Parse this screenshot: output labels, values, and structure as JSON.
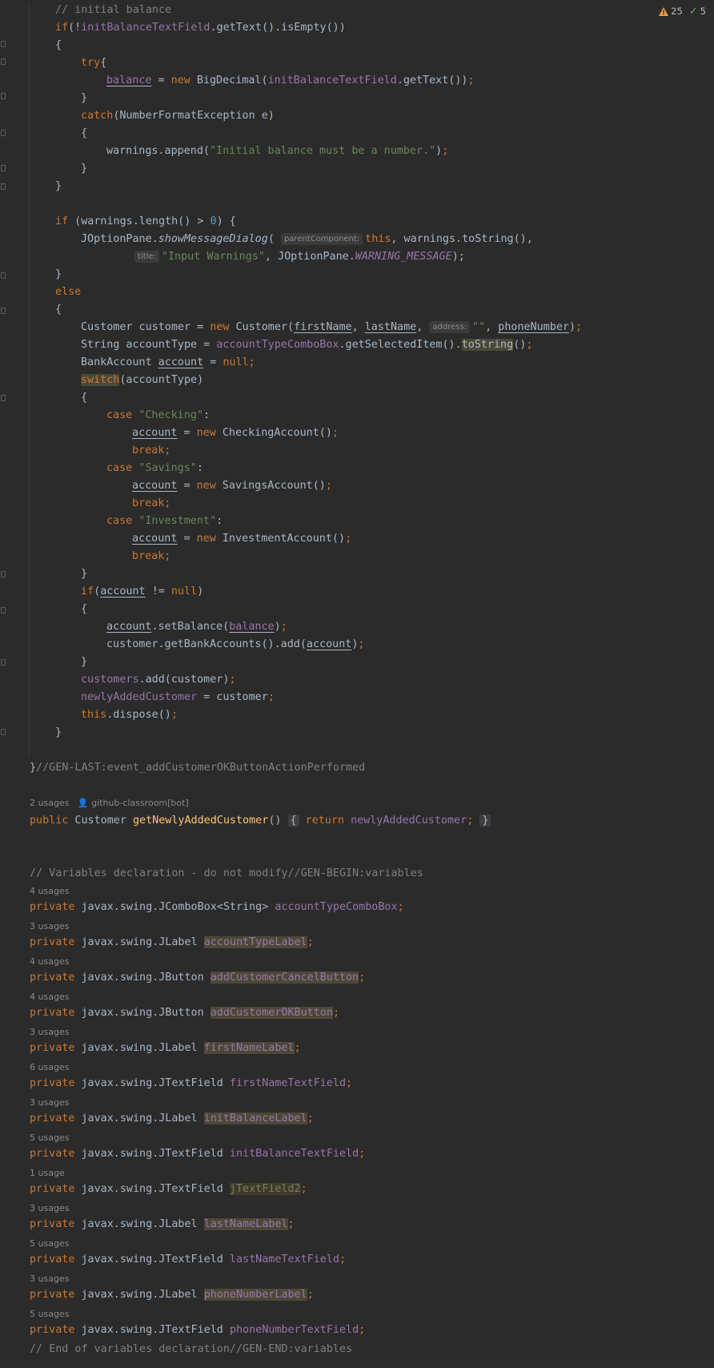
{
  "inspections": {
    "warnings_count": "25",
    "weak_warnings_count": "5"
  },
  "code": {
    "l01": "// initial balance",
    "l02a": "if",
    "l02b": "(!",
    "l02c": "initBalanceTextField",
    "l02d": ".getText().isEmpty())",
    "brace_open": "{",
    "brace_close": "}",
    "try_kw": "try",
    "l05_field": "balance",
    "l05_eq": " = ",
    "l05_new": "new",
    "l05_rest": " BigDecimal(",
    "l05_field2": "initBalanceTextField",
    "l05_end": ".getText())",
    "semi": ";",
    "catch_kw": "catch",
    "catch_rest": "(NumberFormatException e)",
    "warn_append": "warnings.append(",
    "warn_msg": "\"Initial balance must be a number.\"",
    "close_paren": ")",
    "if_kw": "if",
    "if_rest1": " (warnings.length() > ",
    "zero": "0",
    "if_rest2": ") {",
    "jop": "JOptionPane.",
    "show_dialog": "showMessageDialog",
    "open_paren": "(",
    "hint_parent": "parentComponent:",
    "this_kw": "this",
    "warn_tostring": ", warnings.toString(),",
    "hint_title": "title:",
    "title_str": "\"Input Warnings\"",
    "comma_jop": ", JOptionPane.",
    "warning_message": "WARNING_MESSAGE",
    "close_paren_semi": ");",
    "else_kw": "else",
    "cust_decl": "Customer customer = ",
    "cust_new": " Customer(",
    "first_name": "firstName",
    "comma_sp": ", ",
    "last_name": "lastName",
    "hint_address": "address:",
    "empty_str": "\"\"",
    "phone_number": "phoneNumber",
    "acct_type_decl": "String accountType = ",
    "acct_combo": "accountTypeComboBox",
    "get_selected": ".getSelectedItem().",
    "to_string": "toString",
    "unit_call": "()",
    "bank_acct_decl": "BankAccount ",
    "account": "account",
    "eq_null_pre": " = ",
    "null_kw": "null",
    "switch_kw": "switch",
    "switch_rest": "(accountType)",
    "case_kw": "case",
    "checking_str": " \"Checking\"",
    "savings_str": " \"Savings\"",
    "investment_str": " \"Investment\"",
    "colon": ":",
    "checking_cls": " CheckingAccount()",
    "savings_cls": " SavingsAccount()",
    "investment_cls": " InvestmentAccount()",
    "break_kw": "break;",
    "not_eq": " != ",
    "set_balance": ".setBalance(",
    "get_bank_accts": "customer.getBankAccounts().add(",
    "customers": "customers",
    "add_customer": ".add(customer)",
    "newly_added": "newlyAddedCustomer",
    "eq_customer": " = customer",
    "dispose": ".dispose()",
    "gen_last": "//GEN-LAST:event_addCustomerOKButtonActionPerformed",
    "usages_2": "2 usages",
    "author": "github-classroom[bot]",
    "public_kw": "public",
    "customer_type": " Customer ",
    "getter_name": "getNewlyAddedCustomer",
    "fold_body_open": "{",
    "return_kw": "return",
    "fold_body_close": "}",
    "vars_begin": "// Variables declaration - do not modify//GEN-BEGIN:variables",
    "private_kw": "private",
    "vars_end": "// End of variables declaration//GEN-END:variables",
    "fields": [
      {
        "usages": "4 usages",
        "type": " javax.swing.JComboBox<String> ",
        "name": "accountTypeComboBox",
        "unused": false
      },
      {
        "usages": "3 usages",
        "type": " javax.swing.JLabel ",
        "name": "accountTypeLabel",
        "unused": true
      },
      {
        "usages": "4 usages",
        "type": " javax.swing.JButton ",
        "name": "addCustomerCancelButton",
        "unused": true
      },
      {
        "usages": "4 usages",
        "type": " javax.swing.JButton ",
        "name": "addCustomerOKButton",
        "unused": true
      },
      {
        "usages": "3 usages",
        "type": " javax.swing.JLabel ",
        "name": "firstNameLabel",
        "unused": true
      },
      {
        "usages": "6 usages",
        "type": " javax.swing.JTextField ",
        "name": "firstNameTextField",
        "unused": false
      },
      {
        "usages": "3 usages",
        "type": " javax.swing.JLabel ",
        "name": "initBalanceLabel",
        "unused": true
      },
      {
        "usages": "5 usages",
        "type": " javax.swing.JTextField ",
        "name": "initBalanceTextField",
        "unused": false
      },
      {
        "usages": "1 usage",
        "type": " javax.swing.JTextField ",
        "name": "jTextField2",
        "unused": "dim"
      },
      {
        "usages": "3 usages",
        "type": " javax.swing.JLabel ",
        "name": "lastNameLabel",
        "unused": true
      },
      {
        "usages": "5 usages",
        "type": " javax.swing.JTextField ",
        "name": "lastNameTextField",
        "unused": false
      },
      {
        "usages": "3 usages",
        "type": " javax.swing.JLabel ",
        "name": "phoneNumberLabel",
        "unused": true
      },
      {
        "usages": "5 usages",
        "type": " javax.swing.JTextField ",
        "name": "phoneNumberTextField",
        "unused": false
      }
    ]
  }
}
